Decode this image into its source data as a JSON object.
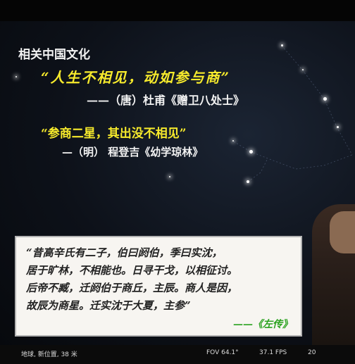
{
  "slide": {
    "section_title": "相关中国文化",
    "quote1": "“人生不相见，动如参与商”",
    "attribution1": "——（唐）杜甫《赠卫八处士》",
    "quote2": "“参商二星，其出没不相见”",
    "attribution2": "—（明） 程登吉《幼学琼林》",
    "passage_lines": [
      "“昔高辛氏有二子，伯曰阏伯，季曰实沈，",
      "居于旷林，不相能也。日寻干戈，以相征讨。",
      "后帝不臧，迁阏伯于商丘，主辰。商人是因，",
      "故辰为商星。迁实沈于大夏，主参”"
    ],
    "passage_source": "——《左传》"
  },
  "status_bar": {
    "location": "地球, 新位置, 38 米",
    "fov": "FOV 64.1°",
    "fps": "37.1 FPS",
    "year": "20"
  }
}
